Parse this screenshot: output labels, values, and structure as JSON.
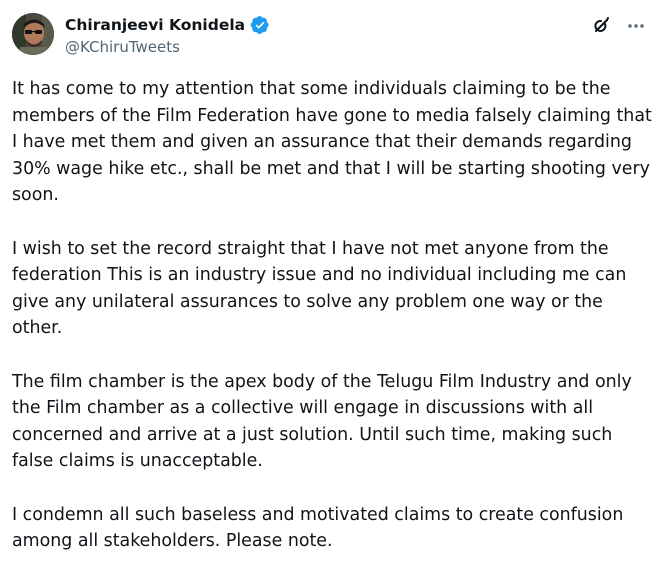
{
  "author": {
    "display_name": "Chiranjeevi Konidela",
    "handle": "@KChiruTweets",
    "verified": true
  },
  "colors": {
    "text": "#0f1419",
    "secondary": "#536471",
    "verified_blue": "#1d9bf0"
  },
  "icons": {
    "grok": "grok-icon",
    "more": "more-icon",
    "verified": "verified-badge-icon"
  },
  "tweet": {
    "paragraphs": [
      "It has come to my attention that some individuals claiming to be the members of the Film Federation have gone to media falsely claiming that I have met them and given an assurance that their demands regarding 30% wage hike etc.,  shall be met and that I will be starting shooting very soon.",
      "I wish to set the record straight that I have not met anyone from the federation This is an industry issue and no individual including me can give any unilateral assurances to solve any problem one way or the other.",
      "The film chamber is the apex body of the Telugu Film Industry and only the Film chamber as a collective will engage in discussions with all concerned and arrive at a just solution. Until such time, making such false claims is unacceptable.",
      "I condemn all such baseless and motivated claims to create confusion among all stakeholders. Please note."
    ]
  }
}
